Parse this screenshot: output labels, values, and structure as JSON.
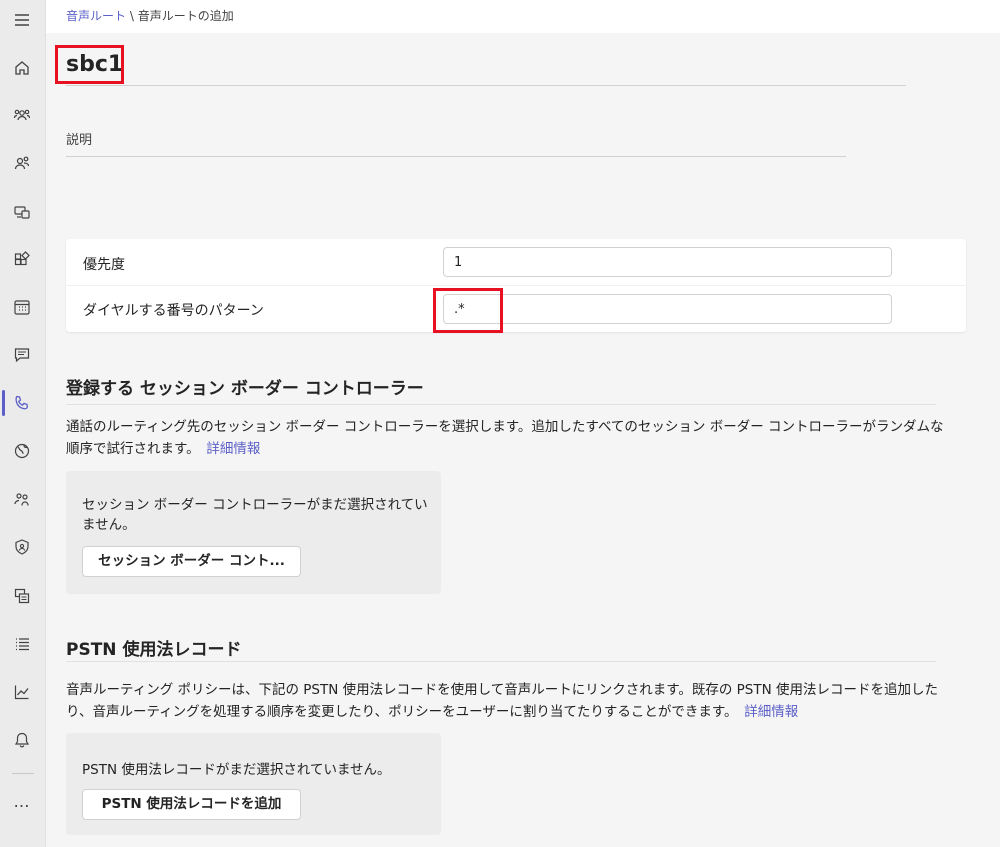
{
  "rail": {
    "icons": [
      "menu-icon",
      "home-icon",
      "teams-icon",
      "users-icon",
      "devices-icon",
      "apps-icon",
      "meetings-icon",
      "messaging-icon",
      "voice-icon",
      "locations-icon",
      "enhanced-encryption-icon",
      "policy-packages-icon",
      "planning-icon",
      "analytics-icon",
      "notifications-icon"
    ],
    "more": "…"
  },
  "breadcrumb": {
    "parent": "音声ルート",
    "separator": " \\ ",
    "current": "音声ルートの追加"
  },
  "page": {
    "title": "sbc1",
    "description_label": "説明"
  },
  "form": {
    "priority_label": "優先度",
    "priority_value": "1",
    "pattern_label": "ダイヤルする番号のパターン",
    "pattern_value": ".*"
  },
  "sbc_section": {
    "title": "登録する セッション ボーダー コントローラー",
    "desc": "通話のルーティング先のセッション ボーダー コントローラーを選択します。追加したすべてのセッション ボーダー コントローラーがランダムな順序で試行されます。",
    "learn_more": "詳細情報",
    "empty_text": "セッション ボーダー コントローラーがまだ選択されていません。",
    "button": "セッション ボーダー コント..."
  },
  "pstn_section": {
    "title": "PSTN 使用法レコード",
    "desc": "音声ルーティング ポリシーは、下記の PSTN 使用法レコードを使用して音声ルートにリンクされます。既存の PSTN 使用法レコードを追加したり、音声ルーティングを処理する順序を変更したり、ポリシーをユーザーに割り当てたりすることができます。",
    "learn_more": "詳細情報",
    "empty_text": "PSTN 使用法レコードがまだ選択されていません。",
    "button": "PSTN 使用法レコードを追加"
  },
  "colors": {
    "accent": "#5b5fc7",
    "highlight": "#e81123"
  }
}
